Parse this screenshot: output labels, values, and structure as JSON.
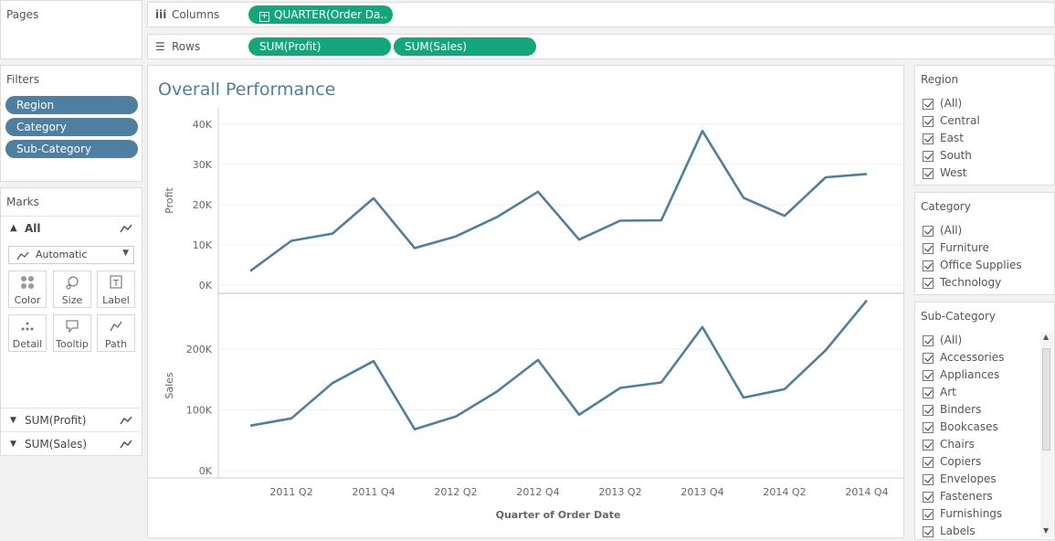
{
  "pages": {
    "title": "Pages"
  },
  "columns": {
    "label": "Columns",
    "pills": [
      "QUARTER(Order Da.."
    ]
  },
  "rows": {
    "label": "Rows",
    "pills": [
      "SUM(Profit)",
      "SUM(Sales)"
    ]
  },
  "filters": {
    "title": "Filters",
    "pills": [
      "Region",
      "Category",
      "Sub-Category"
    ]
  },
  "marks": {
    "title": "Marks",
    "all_label": "All",
    "mark_type": "Automatic",
    "buttons": [
      "Color",
      "Size",
      "Label",
      "Detail",
      "Tooltip",
      "Path"
    ],
    "measures": [
      "SUM(Profit)",
      "SUM(Sales)"
    ]
  },
  "viz": {
    "title": "Overall Performance"
  },
  "region_filter": {
    "title": "Region",
    "items": [
      "(All)",
      "Central",
      "East",
      "South",
      "West"
    ]
  },
  "category_filter": {
    "title": "Category",
    "items": [
      "(All)",
      "Furniture",
      "Office Supplies",
      "Technology"
    ]
  },
  "subcategory_filter": {
    "title": "Sub-Category",
    "items": [
      "(All)",
      "Accessories",
      "Appliances",
      "Art",
      "Binders",
      "Bookcases",
      "Chairs",
      "Copiers",
      "Envelopes",
      "Fasteners",
      "Furnishings",
      "Labels"
    ]
  },
  "colors": {
    "line": "#4e7fa0",
    "pill_green": "#12a679",
    "pill_blue": "#4e7fa0",
    "title": "#4e7fa0"
  },
  "chart_data": [
    {
      "type": "line",
      "x": [
        "2011 Q1",
        "2011 Q2",
        "2011 Q3",
        "2011 Q4",
        "2012 Q1",
        "2012 Q2",
        "2012 Q3",
        "2012 Q4",
        "2013 Q1",
        "2013 Q2",
        "2013 Q3",
        "2013 Q4",
        "2014 Q1",
        "2014 Q2",
        "2014 Q3",
        "2014 Q4"
      ],
      "values": [
        3500,
        11000,
        12800,
        21600,
        9200,
        12100,
        16900,
        23200,
        11300,
        16000,
        16100,
        38300,
        21700,
        17200,
        26800,
        27600
      ],
      "ylabel": "Profit",
      "yticks": [
        "0K",
        "10K",
        "20K",
        "30K",
        "40K"
      ],
      "ylim": [
        0,
        42000
      ]
    },
    {
      "type": "line",
      "x": [
        "2011 Q1",
        "2011 Q2",
        "2011 Q3",
        "2011 Q4",
        "2012 Q1",
        "2012 Q2",
        "2012 Q3",
        "2012 Q4",
        "2013 Q1",
        "2013 Q2",
        "2013 Q3",
        "2013 Q4",
        "2014 Q1",
        "2014 Q2",
        "2014 Q3",
        "2014 Q4"
      ],
      "values": [
        74000,
        86000,
        144000,
        180000,
        68000,
        89000,
        130000,
        182000,
        92000,
        136000,
        145000,
        236000,
        120000,
        134000,
        198000,
        280000
      ],
      "ylabel": "Sales",
      "yticks": [
        "0K",
        "100K",
        "200K"
      ],
      "ylim": [
        0,
        290000
      ]
    }
  ],
  "xaxis": {
    "title": "Quarter of Order Date",
    "ticks": [
      "2011 Q2",
      "2011 Q4",
      "2012 Q2",
      "2012 Q4",
      "2013 Q2",
      "2013 Q4",
      "2014 Q2",
      "2014 Q4"
    ]
  }
}
